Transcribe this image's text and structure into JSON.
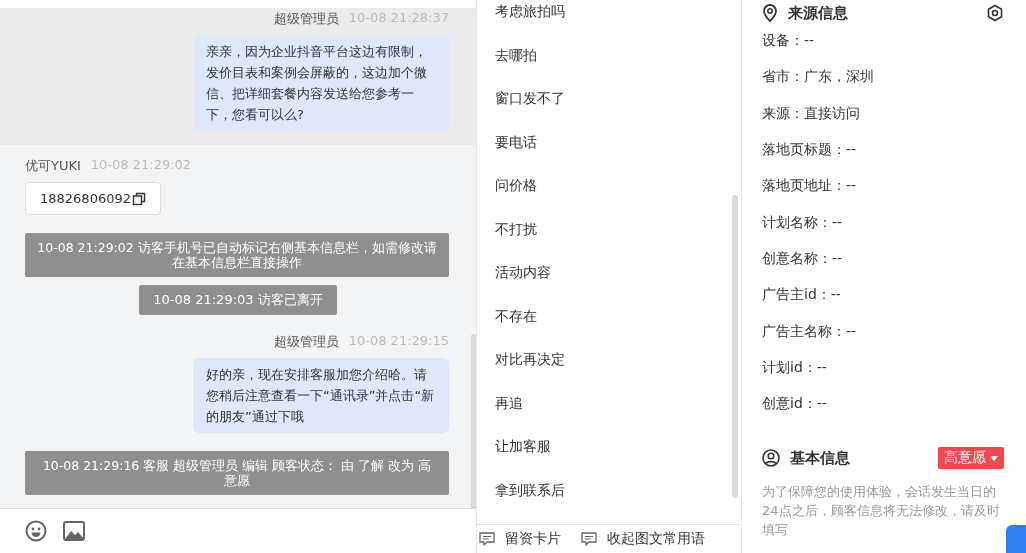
{
  "chat": {
    "messages": [
      {
        "kind": "agent",
        "sender": "超级管理员",
        "time": "10-08 21:28:37",
        "text": "亲亲，因为企业抖音平台这边有限制，发价目表和案例会屏蔽的，这边加个微信、把详细套餐内容发送给您参考一下，您看可以么?",
        "highlighted": true
      },
      {
        "kind": "visitor",
        "sender": "优可YUKI",
        "time": "10-08 21:29:02",
        "text": "18826806092",
        "highlighted": false
      },
      {
        "kind": "system",
        "text": "10-08 21:29:02 访客手机号已自动标记右侧基本信息栏，如需修改请在基本信息栏直接操作"
      },
      {
        "kind": "notice",
        "text": "10-08 21:29:03 访客已离开"
      },
      {
        "kind": "agent",
        "sender": "超级管理员",
        "time": "10-08 21:29:15",
        "text": "好的亲，现在安排客服加您介绍哈。请您稍后注意查看一下“通讯录”并点击“新的朋友”通过下哦",
        "highlighted": false
      },
      {
        "kind": "system",
        "text": "10-08 21:29:16 客服 超级管理员 编辑 顾客状态： 由 了解 改为 高意愿"
      }
    ]
  },
  "phrases": {
    "items": [
      "考虑旅拍吗",
      "去哪拍",
      "窗口发不了",
      "要电话",
      "问价格",
      "不打扰",
      "活动内容",
      "不存在",
      "对比再决定",
      "再追",
      "让加客服",
      "拿到联系后"
    ],
    "actions": [
      "留资卡片",
      "收起图文常用语"
    ]
  },
  "source_info": {
    "title": "来源信息",
    "fields": [
      "设备：--",
      "省市：广东，深圳",
      "来源：直接访问",
      "落地页标题：--",
      "落地页地址：--",
      "计划名称：--",
      "创意名称：--",
      "广告主id：--",
      "广告主名称：--",
      "计划id：--",
      "创意id：--"
    ]
  },
  "basic_info": {
    "title": "基本信息",
    "status": "高意愿",
    "notice": "为了保障您的使用体验，会话发生当日的24点之后，顾客信息将无法修改，请及时填写"
  }
}
